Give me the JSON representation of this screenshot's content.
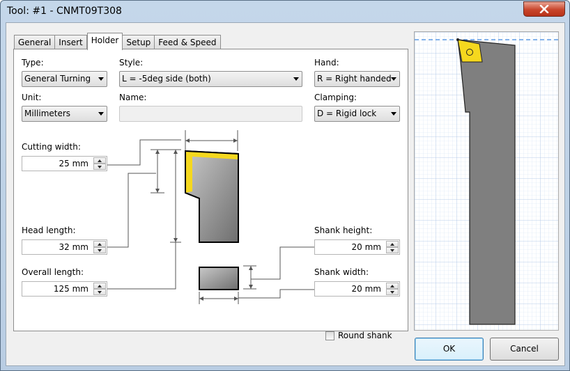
{
  "window": {
    "title": "Tool: #1 - CNMT09T308"
  },
  "tabs": [
    {
      "label": "General"
    },
    {
      "label": "Insert"
    },
    {
      "label": "Holder"
    },
    {
      "label": "Setup"
    },
    {
      "label": "Feed & Speed"
    }
  ],
  "form": {
    "type": {
      "label": "Type:",
      "value": "General Turning"
    },
    "style": {
      "label": "Style:",
      "value": "L = -5deg side (both)"
    },
    "hand": {
      "label": "Hand:",
      "value": "R = Right handed"
    },
    "unit": {
      "label": "Unit:",
      "value": "Millimeters"
    },
    "name": {
      "label": "Name:",
      "value": ""
    },
    "clamping": {
      "label": "Clamping:",
      "value": "D = Rigid lock"
    },
    "cutting_width": {
      "label": "Cutting width:",
      "value": "25 mm"
    },
    "head_length": {
      "label": "Head length:",
      "value": "32 mm"
    },
    "overall_length": {
      "label": "Overall length:",
      "value": "125 mm"
    },
    "shank_height": {
      "label": "Shank height:",
      "value": "20 mm"
    },
    "shank_width": {
      "label": "Shank width:",
      "value": "20 mm"
    },
    "round_shank": {
      "label": "Round shank",
      "checked": false
    }
  },
  "buttons": {
    "ok": "OK",
    "cancel": "Cancel"
  },
  "colors": {
    "insert_yellow": "#f5d81e",
    "holder_gray": "#808080",
    "grid_blue": "#b7cde9"
  },
  "icons": {
    "close": "close-icon",
    "spin_up": "arrow-up-icon",
    "spin_down": "arrow-down-icon",
    "combo": "chevron-down-icon"
  }
}
